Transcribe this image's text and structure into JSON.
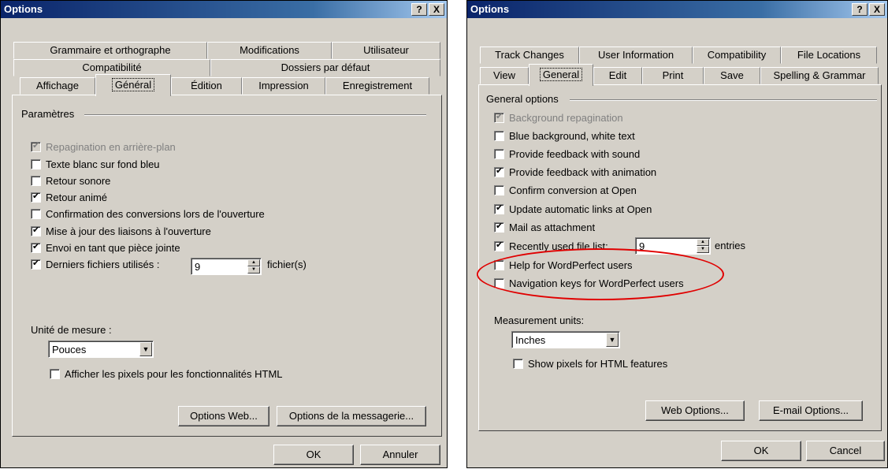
{
  "fr": {
    "title": "Options",
    "help_btn": "?",
    "close_btn": "X",
    "tabs": [
      "Grammaire et orthographe",
      "Modifications",
      "Utilisateur",
      "Compatibilité",
      "Dossiers par défaut",
      "Affichage",
      "Général",
      "Édition",
      "Impression",
      "Enregistrement"
    ],
    "group": "Paramètres",
    "options": [
      {
        "label": "Repagination en arrière-plan",
        "checked": true,
        "disabled": true
      },
      {
        "label": "Texte blanc sur fond bleu",
        "checked": false
      },
      {
        "label": "Retour sonore",
        "checked": false
      },
      {
        "label": "Retour animé",
        "checked": true
      },
      {
        "label": "Confirmation des conversions lors de l'ouverture",
        "checked": false
      },
      {
        "label": "Mise à jour des liaisons à l'ouverture",
        "checked": true
      },
      {
        "label": "Envoi en tant que pièce jointe",
        "checked": true
      },
      {
        "label": "Derniers fichiers utilisés :",
        "checked": true
      }
    ],
    "recent_value": "9",
    "recent_suffix": "fichier(s)",
    "units_label": "Unité de mesure :",
    "units_value": "Pouces",
    "pixels_label": "Afficher les pixels pour les fonctionnalités HTML",
    "web_options": "Options Web...",
    "mail_options": "Options de la messagerie...",
    "ok": "OK",
    "cancel": "Annuler"
  },
  "en": {
    "title": "Options",
    "help_btn": "?",
    "close_btn": "X",
    "tabs": [
      "Track Changes",
      "User Information",
      "Compatibility",
      "File Locations",
      "View",
      "General",
      "Edit",
      "Print",
      "Save",
      "Spelling & Grammar"
    ],
    "group": "General options",
    "options": [
      {
        "label": "Background repagination",
        "checked": true,
        "disabled": true
      },
      {
        "label": "Blue background, white text",
        "checked": false
      },
      {
        "label": "Provide feedback with sound",
        "checked": false
      },
      {
        "label": "Provide feedback with animation",
        "checked": true
      },
      {
        "label": "Confirm conversion at Open",
        "checked": false
      },
      {
        "label": "Update automatic links at Open",
        "checked": true
      },
      {
        "label": "Mail as attachment",
        "checked": true
      },
      {
        "label": "Recently used file list:",
        "checked": true
      },
      {
        "label": "Help for WordPerfect users",
        "checked": false
      },
      {
        "label": "Navigation keys for WordPerfect users",
        "checked": false
      }
    ],
    "recent_value": "9",
    "recent_suffix": "entries",
    "units_label": "Measurement units:",
    "units_value": "Inches",
    "pixels_label": "Show pixels for HTML features",
    "web_options": "Web Options...",
    "mail_options": "E-mail Options...",
    "ok": "OK",
    "cancel": "Cancel"
  },
  "highlight_color": "#e00000"
}
